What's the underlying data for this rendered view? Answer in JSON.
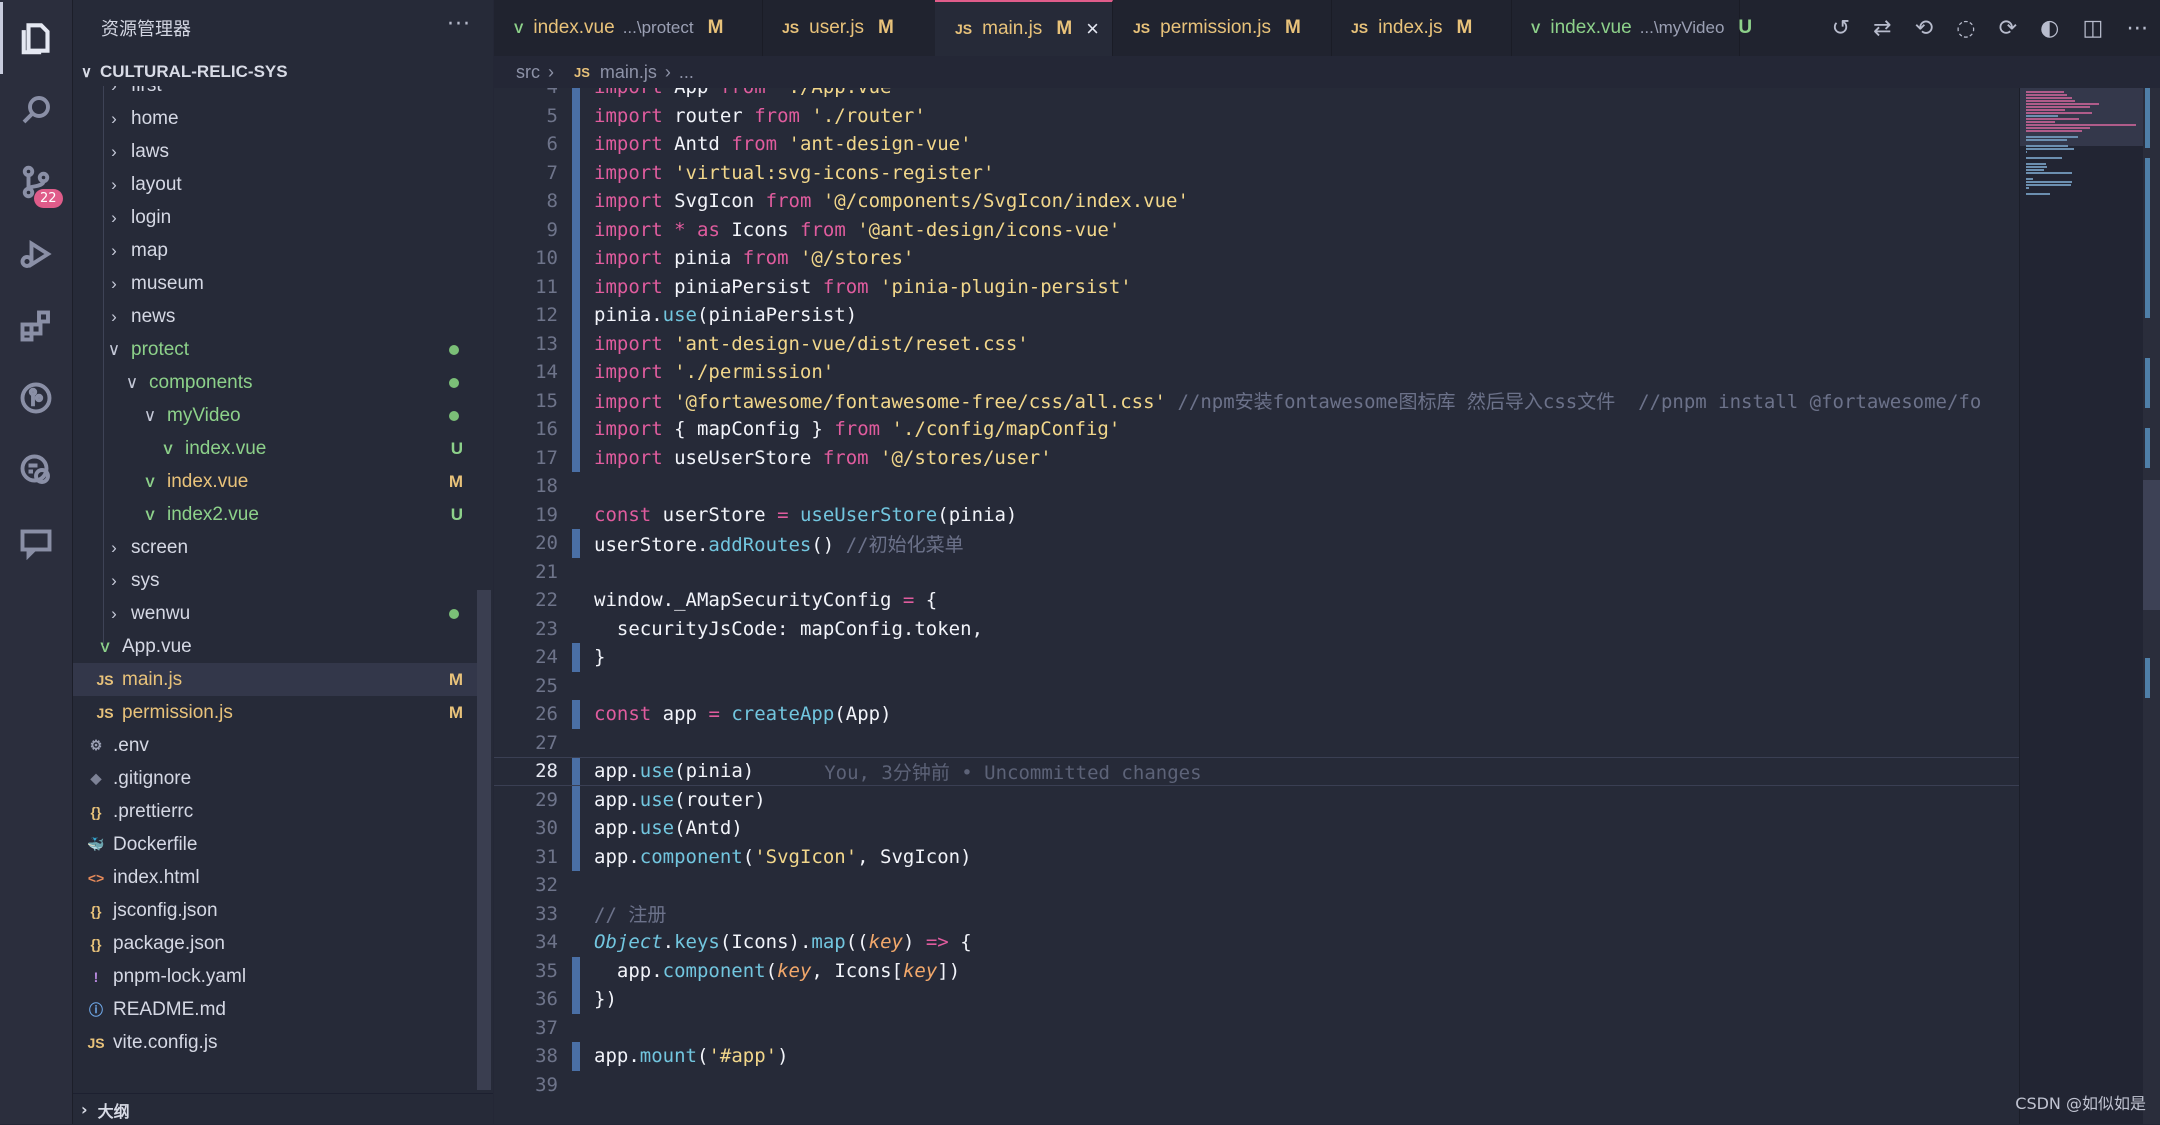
{
  "explorer": {
    "title": "资源管理器",
    "more": "···",
    "root": "CULTURAL-RELIC-SYS",
    "items": [
      {
        "label": "first",
        "type": "folder",
        "open": false,
        "depth": 1,
        "status": "",
        "dot": false,
        "color": "def"
      },
      {
        "label": "home",
        "type": "folder",
        "open": false,
        "depth": 1,
        "status": "",
        "dot": false,
        "color": "def"
      },
      {
        "label": "laws",
        "type": "folder",
        "open": false,
        "depth": 1,
        "status": "",
        "dot": false,
        "color": "def"
      },
      {
        "label": "layout",
        "type": "folder",
        "open": false,
        "depth": 1,
        "status": "",
        "dot": false,
        "color": "def"
      },
      {
        "label": "login",
        "type": "folder",
        "open": false,
        "depth": 1,
        "status": "",
        "dot": false,
        "color": "def"
      },
      {
        "label": "map",
        "type": "folder",
        "open": false,
        "depth": 1,
        "status": "",
        "dot": false,
        "color": "def"
      },
      {
        "label": "museum",
        "type": "folder",
        "open": false,
        "depth": 1,
        "status": "",
        "dot": false,
        "color": "def"
      },
      {
        "label": "news",
        "type": "folder",
        "open": false,
        "depth": 1,
        "status": "",
        "dot": false,
        "color": "def"
      },
      {
        "label": "protect",
        "type": "folder",
        "open": true,
        "depth": 1,
        "status": "",
        "dot": true,
        "color": "new"
      },
      {
        "label": "components",
        "type": "folder",
        "open": true,
        "depth": 2,
        "status": "",
        "dot": true,
        "color": "new"
      },
      {
        "label": "myVideo",
        "type": "folder",
        "open": true,
        "depth": 3,
        "status": "",
        "dot": true,
        "color": "new"
      },
      {
        "label": "index.vue",
        "type": "vue",
        "open": false,
        "depth": 4,
        "status": "U",
        "dot": false,
        "color": "new"
      },
      {
        "label": "index.vue",
        "type": "vue",
        "open": false,
        "depth": 3,
        "status": "M",
        "dot": false,
        "color": "mod"
      },
      {
        "label": "index2.vue",
        "type": "vue",
        "open": false,
        "depth": 3,
        "status": "U",
        "dot": false,
        "color": "new"
      },
      {
        "label": "screen",
        "type": "folder",
        "open": false,
        "depth": 1,
        "status": "",
        "dot": false,
        "color": "def"
      },
      {
        "label": "sys",
        "type": "folder",
        "open": false,
        "depth": 1,
        "status": "",
        "dot": false,
        "color": "def"
      },
      {
        "label": "wenwu",
        "type": "folder",
        "open": false,
        "depth": 1,
        "status": "",
        "dot": true,
        "color": "def"
      },
      {
        "label": "App.vue",
        "type": "vue",
        "open": false,
        "depth": 0.5,
        "status": "",
        "dot": false,
        "color": "def"
      },
      {
        "label": "main.js",
        "type": "js",
        "open": false,
        "depth": 0.5,
        "status": "M",
        "dot": false,
        "color": "mod",
        "selected": true
      },
      {
        "label": "permission.js",
        "type": "js",
        "open": false,
        "depth": 0.5,
        "status": "M",
        "dot": false,
        "color": "mod"
      },
      {
        "label": ".env",
        "type": "gear",
        "open": false,
        "depth": 0,
        "status": "",
        "dot": false,
        "color": "def"
      },
      {
        "label": ".gitignore",
        "type": "git",
        "open": false,
        "depth": 0,
        "status": "",
        "dot": false,
        "color": "def"
      },
      {
        "label": ".prettierrc",
        "type": "json",
        "open": false,
        "depth": 0,
        "status": "",
        "dot": false,
        "color": "def"
      },
      {
        "label": "Dockerfile",
        "type": "docker",
        "open": false,
        "depth": 0,
        "status": "",
        "dot": false,
        "color": "def"
      },
      {
        "label": "index.html",
        "type": "html",
        "open": false,
        "depth": 0,
        "status": "",
        "dot": false,
        "color": "def"
      },
      {
        "label": "jsconfig.json",
        "type": "json",
        "open": false,
        "depth": 0,
        "status": "",
        "dot": false,
        "color": "def"
      },
      {
        "label": "package.json",
        "type": "json",
        "open": false,
        "depth": 0,
        "status": "",
        "dot": false,
        "color": "def"
      },
      {
        "label": "pnpm-lock.yaml",
        "type": "yaml",
        "open": false,
        "depth": 0,
        "status": "",
        "dot": false,
        "color": "def"
      },
      {
        "label": "README.md",
        "type": "info",
        "open": false,
        "depth": 0,
        "status": "",
        "dot": false,
        "color": "def"
      },
      {
        "label": "vite.config.js",
        "type": "js",
        "open": false,
        "depth": 0,
        "status": "",
        "dot": false,
        "color": "def"
      }
    ],
    "outline": "大纲"
  },
  "activity": {
    "scm_badge": "22"
  },
  "tabs": [
    {
      "label": "index.vue",
      "desc": "...\\protect",
      "status": "M",
      "type": "vue",
      "active": false
    },
    {
      "label": "user.js",
      "desc": "",
      "status": "M",
      "type": "js",
      "active": false
    },
    {
      "label": "main.js",
      "desc": "",
      "status": "M",
      "type": "js",
      "active": true
    },
    {
      "label": "permission.js",
      "desc": "",
      "status": "M",
      "type": "js",
      "active": false
    },
    {
      "label": "index.js",
      "desc": "",
      "status": "M",
      "type": "js",
      "active": false
    },
    {
      "label": "index.vue",
      "desc": "...\\myVideo",
      "status": "U",
      "type": "vue",
      "active": false
    }
  ],
  "breadcrumb": {
    "folder": "src",
    "file": "main.js",
    "rest": "..."
  },
  "editor": {
    "current_line": 28,
    "blame": "You, 3分钟前 • Uncommitted changes",
    "lines": [
      {
        "n": 4,
        "src": "import App from './App.vue'"
      },
      {
        "n": 5,
        "src": "import router from './router'"
      },
      {
        "n": 6,
        "src": "import Antd from 'ant-design-vue'"
      },
      {
        "n": 7,
        "src": "import 'virtual:svg-icons-register'"
      },
      {
        "n": 8,
        "src": "import SvgIcon from '@/components/SvgIcon/index.vue'"
      },
      {
        "n": 9,
        "src": "import * as Icons from '@ant-design/icons-vue'"
      },
      {
        "n": 10,
        "src": "import pinia from '@/stores'"
      },
      {
        "n": 11,
        "src": "import piniaPersist from 'pinia-plugin-persist'"
      },
      {
        "n": 12,
        "src": "pinia.use(piniaPersist)"
      },
      {
        "n": 13,
        "src": "import 'ant-design-vue/dist/reset.css'"
      },
      {
        "n": 14,
        "src": "import './permission'"
      },
      {
        "n": 15,
        "src": "import '@fortawesome/fontawesome-free/css/all.css' //npm安装fontawesome图标库 然后导入css文件  //pnpm install @fortawesome/fo"
      },
      {
        "n": 16,
        "src": "import { mapConfig } from './config/mapConfig'"
      },
      {
        "n": 17,
        "src": "import useUserStore from '@/stores/user'"
      },
      {
        "n": 18,
        "src": ""
      },
      {
        "n": 19,
        "src": "const userStore = useUserStore(pinia)"
      },
      {
        "n": 20,
        "src": "userStore.addRoutes() //初始化菜单"
      },
      {
        "n": 21,
        "src": ""
      },
      {
        "n": 22,
        "src": "window._AMapSecurityConfig = {"
      },
      {
        "n": 23,
        "src": "  securityJsCode: mapConfig.token,"
      },
      {
        "n": 24,
        "src": "}"
      },
      {
        "n": 25,
        "src": ""
      },
      {
        "n": 26,
        "src": "const app = createApp(App)"
      },
      {
        "n": 27,
        "src": ""
      },
      {
        "n": 28,
        "src": "app.use(pinia)"
      },
      {
        "n": 29,
        "src": "app.use(router)"
      },
      {
        "n": 30,
        "src": "app.use(Antd)"
      },
      {
        "n": 31,
        "src": "app.component('SvgIcon', SvgIcon)"
      },
      {
        "n": 32,
        "src": ""
      },
      {
        "n": 33,
        "src": "// 注册"
      },
      {
        "n": 34,
        "src": "Object.keys(Icons).map((key) => {"
      },
      {
        "n": 35,
        "src": "  app.component(key, Icons[key])"
      },
      {
        "n": 36,
        "src": "})"
      },
      {
        "n": 37,
        "src": ""
      },
      {
        "n": 38,
        "src": "app.mount('#app')"
      },
      {
        "n": 39,
        "src": ""
      }
    ]
  },
  "watermark": "CSDN @如似如是",
  "colors": {
    "accent": "#e05c8a",
    "modified": "#e8c27a",
    "untracked": "#8dd18a"
  }
}
